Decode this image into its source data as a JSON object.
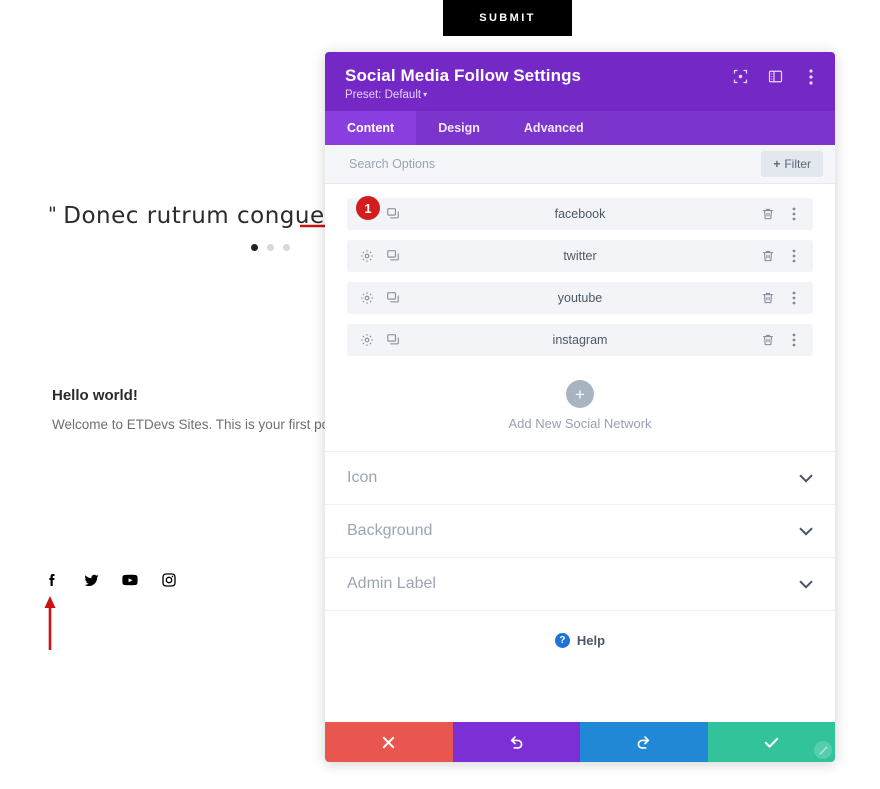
{
  "page": {
    "submit_button": "SUBMIT",
    "testimonial_quote_mark": "\"",
    "testimonial_text": "Donec rutrum congue leo e",
    "slider_dots": [
      "active",
      "inactive",
      "inactive"
    ],
    "post_title": "Hello world!",
    "post_body": "Welcome to ETDevs Sites. This is your first post. E",
    "social_icons": [
      {
        "name": "facebook-icon",
        "glyph": "f"
      },
      {
        "name": "twitter-icon",
        "glyph": "twitter"
      },
      {
        "name": "youtube-icon",
        "glyph": "youtube"
      },
      {
        "name": "instagram-icon",
        "glyph": "instagram"
      }
    ]
  },
  "annotations": {
    "badge_number": "1",
    "badge_color": "#d31c1c",
    "arrow_color": "#cc1111"
  },
  "panel": {
    "title": "Social Media Follow Settings",
    "preset_label": "Preset: Default",
    "preset_caret": "▾",
    "header_icons": [
      {
        "name": "focus-target-icon"
      },
      {
        "name": "panel-layout-icon"
      },
      {
        "name": "more-vertical-icon"
      }
    ],
    "tabs": [
      {
        "label": "Content",
        "active": true
      },
      {
        "label": "Design",
        "active": false
      },
      {
        "label": "Advanced",
        "active": false
      }
    ],
    "search": {
      "placeholder": "Search Options",
      "value": ""
    },
    "filter_button": {
      "plus": "+",
      "label": "Filter"
    },
    "networks": [
      {
        "name": "facebook"
      },
      {
        "name": "twitter"
      },
      {
        "name": "youtube"
      },
      {
        "name": "instagram"
      }
    ],
    "add_network": {
      "plus": "+",
      "label": "Add New Social Network"
    },
    "sections": [
      {
        "title": "Icon"
      },
      {
        "title": "Background"
      },
      {
        "title": "Admin Label"
      }
    ],
    "help": {
      "mark": "?",
      "label": "Help"
    },
    "actions": [
      {
        "name": "cancel-button",
        "color": "#e8564f"
      },
      {
        "name": "undo-button",
        "color": "#7b2fd4"
      },
      {
        "name": "redo-button",
        "color": "#2088d4"
      },
      {
        "name": "save-button",
        "color": "#32c39a"
      }
    ]
  }
}
